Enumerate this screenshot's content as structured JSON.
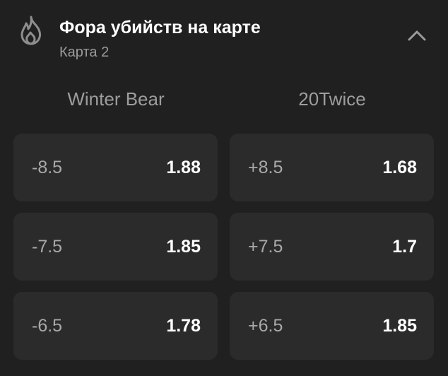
{
  "market": {
    "title": "Фора убийств на карте",
    "subtitle": "Карта 2",
    "icon": "flame-icon",
    "collapse_icon": "chevron-up-icon"
  },
  "teams": {
    "left": "Winter Bear",
    "right": "20Twice"
  },
  "rows": [
    {
      "left": {
        "line": "-8.5",
        "odds": "1.88"
      },
      "right": {
        "line": "+8.5",
        "odds": "1.68"
      }
    },
    {
      "left": {
        "line": "-7.5",
        "odds": "1.85"
      },
      "right": {
        "line": "+7.5",
        "odds": "1.7"
      }
    },
    {
      "left": {
        "line": "-6.5",
        "odds": "1.78"
      },
      "right": {
        "line": "+6.5",
        "odds": "1.85"
      }
    }
  ],
  "colors": {
    "background": "#202020",
    "cell_background": "#2b2b2b",
    "text_primary": "#ffffff",
    "text_secondary": "#9b9b9b"
  }
}
